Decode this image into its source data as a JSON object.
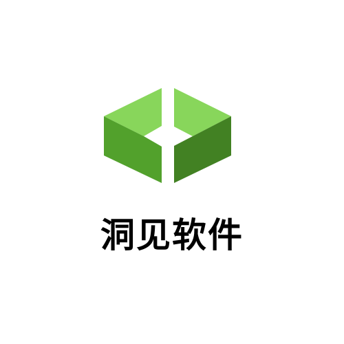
{
  "brand": {
    "name": "洞见软件"
  },
  "logo": {
    "icon": "green-split-box-logo-icon",
    "colors": {
      "light_green": "#88d65b",
      "dark_green": "#428123",
      "medium_green": "#52a12c"
    }
  }
}
